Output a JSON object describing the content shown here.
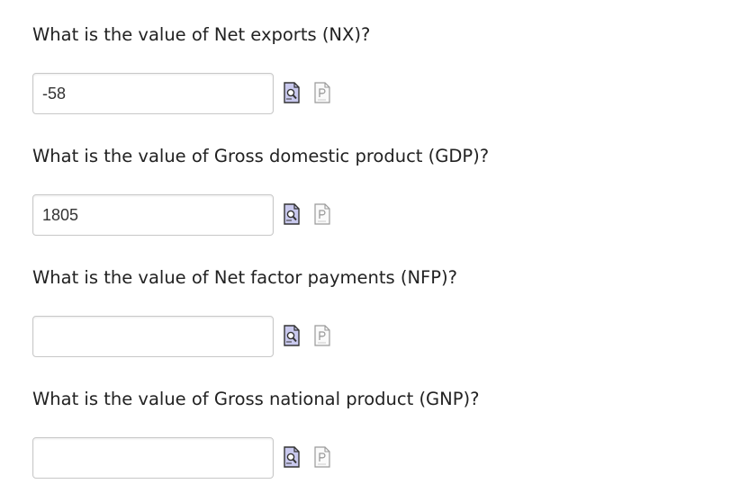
{
  "questions": [
    {
      "id": "nx",
      "prompt": "What is the value of Net exports (NX)?",
      "value": "-58",
      "placeholder": "",
      "icons": [
        "preview-magnifier-icon",
        "help-page-icon"
      ]
    },
    {
      "id": "gdp",
      "prompt": "What is the value of Gross domestic product (GDP)?",
      "value": "1805",
      "placeholder": "",
      "icons": [
        "preview-magnifier-icon",
        "help-page-icon"
      ]
    },
    {
      "id": "nfp",
      "prompt": "What is the value of Net factor payments (NFP)?",
      "value": "",
      "placeholder": "",
      "icons": [
        "preview-magnifier-icon",
        "help-page-icon"
      ]
    },
    {
      "id": "gnp",
      "prompt": "What is the value of Gross national product (GNP)?",
      "value": "",
      "placeholder": "",
      "icons": [
        "preview-magnifier-icon",
        "help-page-icon"
      ]
    }
  ],
  "colors": {
    "text": "#222222",
    "input_border": "#c8c8c8",
    "preview_icon_fill": "#c9c9ee",
    "preview_icon_stroke": "#333333",
    "help_icon_stroke": "#9a9a9a"
  }
}
